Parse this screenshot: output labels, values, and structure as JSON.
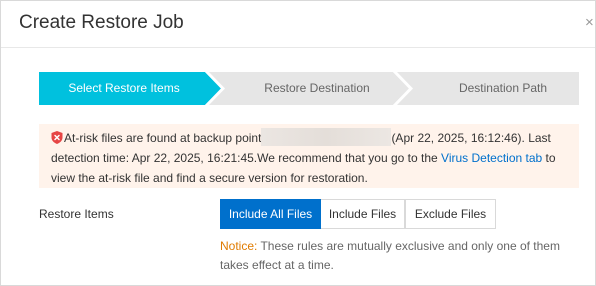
{
  "dialog": {
    "title": "Create Restore Job",
    "close_glyph": "×"
  },
  "steps": [
    {
      "label": "Select Restore Items",
      "state": "active"
    },
    {
      "label": "Restore Destination",
      "state": "inactive"
    },
    {
      "label": "Destination Path",
      "state": "inactive"
    }
  ],
  "warning": {
    "icon": "shield-error-icon",
    "text_before": "At-risk files are found at backup point",
    "redacted": "",
    "text_after": "(Apr 22, 2025, 16:12:46). Last detection time: Apr 22, 2025, 16:21:45.We recommend that you go to the ",
    "link": "Virus Detection tab",
    "text_end": " to view the at-risk file and find a secure version for restoration."
  },
  "restore_items": {
    "label": "Restore Items",
    "options": [
      "Include All Files",
      "Include Files",
      "Exclude Files"
    ],
    "selected": "Include All Files",
    "notice_label": "Notice:",
    "notice_text": " These rules are mutually exclusive and only one of them takes effect at a time."
  },
  "colors": {
    "active_step": "#00c1de",
    "primary": "#0070cc",
    "warning_bg": "#fff3eb",
    "notice_label": "#e07b00"
  }
}
